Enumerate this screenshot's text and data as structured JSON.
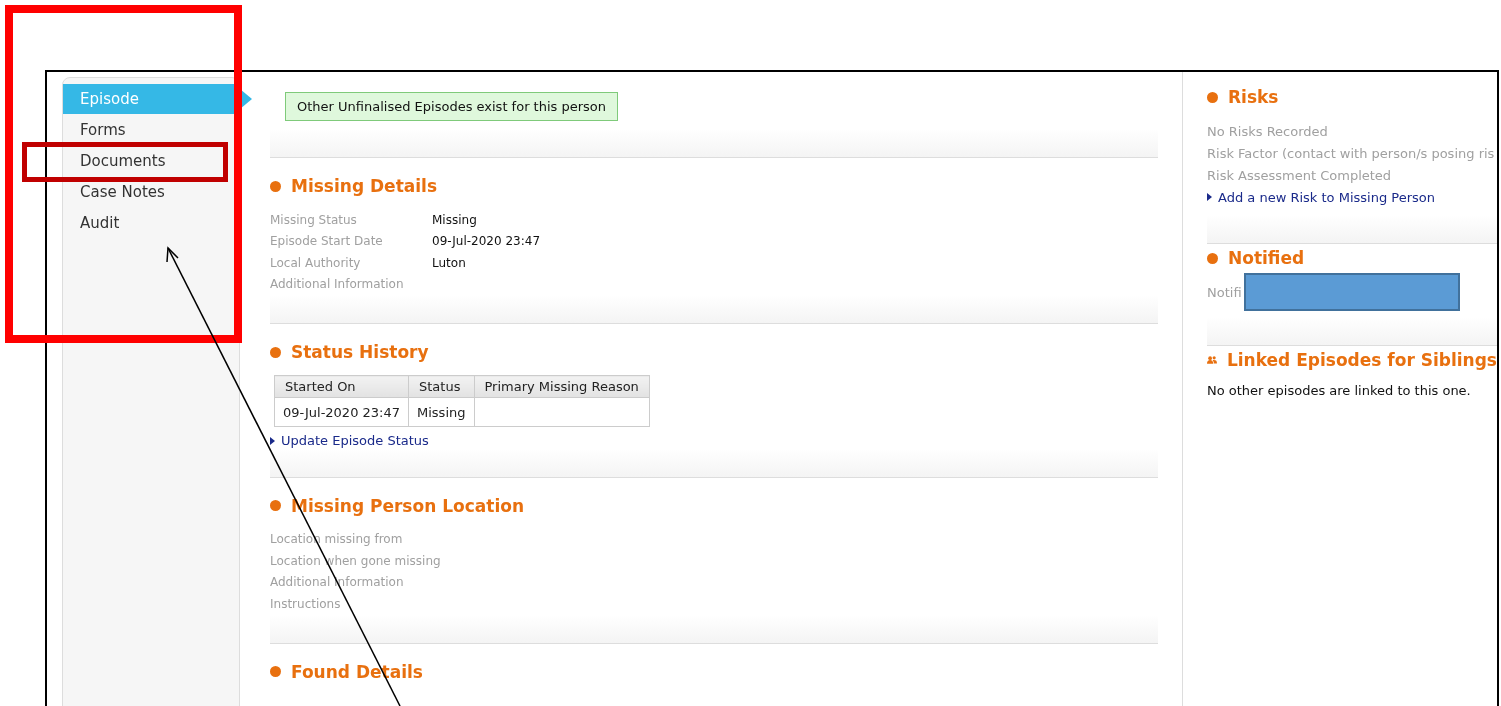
{
  "sidebar": {
    "items": [
      {
        "label": "Episode",
        "selected": true
      },
      {
        "label": "Forms",
        "selected": false
      },
      {
        "label": "Documents",
        "selected": false
      },
      {
        "label": "Case Notes",
        "selected": false
      },
      {
        "label": "Audit",
        "selected": false
      }
    ]
  },
  "notice": "Other Unfinalised Episodes exist for this person",
  "sections": [
    {
      "kind": "fields",
      "title": "Missing Details",
      "fields": [
        {
          "label": "Missing Status",
          "value": "Missing"
        },
        {
          "label": "Episode Start Date",
          "value": "09-Jul-2020 23:47"
        },
        {
          "label": "Local Authority",
          "value": "Luton"
        },
        {
          "label": "Additional Information"
        }
      ]
    },
    {
      "kind": "table",
      "title": "Status History",
      "table": {
        "columns": [
          "Started On",
          "Status",
          "Primary Missing Reason"
        ],
        "rows": [
          {
            "cells": [
              "09-Jul-2020 23:47",
              "Missing"
            ]
          }
        ]
      },
      "link": "Update Episode Status"
    },
    {
      "kind": "fields",
      "title": "Missing Person Location",
      "fields": [
        {
          "label": "Location missing from"
        },
        {
          "label": "Location when gone missing"
        },
        {
          "label": "Additional Information"
        },
        {
          "label": "Instructions"
        }
      ]
    },
    {
      "kind": "heading",
      "title": "Found Details"
    }
  ],
  "right": {
    "sections": [
      {
        "kind": "list",
        "title": "Risks",
        "lines": [
          "No Risks Recorded",
          "Risk Factor (contact with person/s posing ris",
          "Risk Assessment Completed"
        ],
        "link": "Add a new Risk to Missing Person"
      },
      {
        "kind": "list",
        "title": "Notified",
        "lines": [
          "Notifi"
        ],
        "redacted": true
      },
      {
        "kind": "linked",
        "title": "Linked Episodes for Siblings",
        "text": "No other episodes are linked to this one."
      }
    ]
  }
}
